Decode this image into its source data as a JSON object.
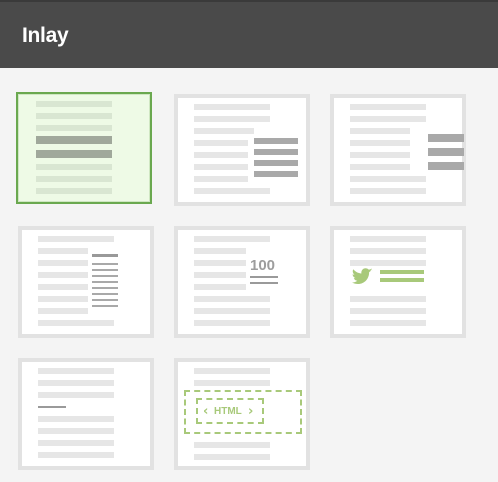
{
  "header": {
    "title": "Inlay"
  },
  "layouts": [
    {
      "id": "text-with-pullquote",
      "selected": true
    },
    {
      "id": "text-with-right-block",
      "selected": false
    },
    {
      "id": "text-with-right-aside",
      "selected": false
    },
    {
      "id": "text-with-right-list",
      "selected": false
    },
    {
      "id": "text-with-number",
      "selected": false
    },
    {
      "id": "text-with-tweet",
      "selected": false
    },
    {
      "id": "text-with-divider",
      "selected": false
    },
    {
      "id": "text-with-html",
      "selected": false
    }
  ],
  "number_tile": {
    "value": "100"
  },
  "html_tile": {
    "label": "HTML"
  },
  "colors": {
    "accent_green": "#a8c97a",
    "selected_border": "#6aa84f",
    "header_bg": "#4a4a4a"
  }
}
